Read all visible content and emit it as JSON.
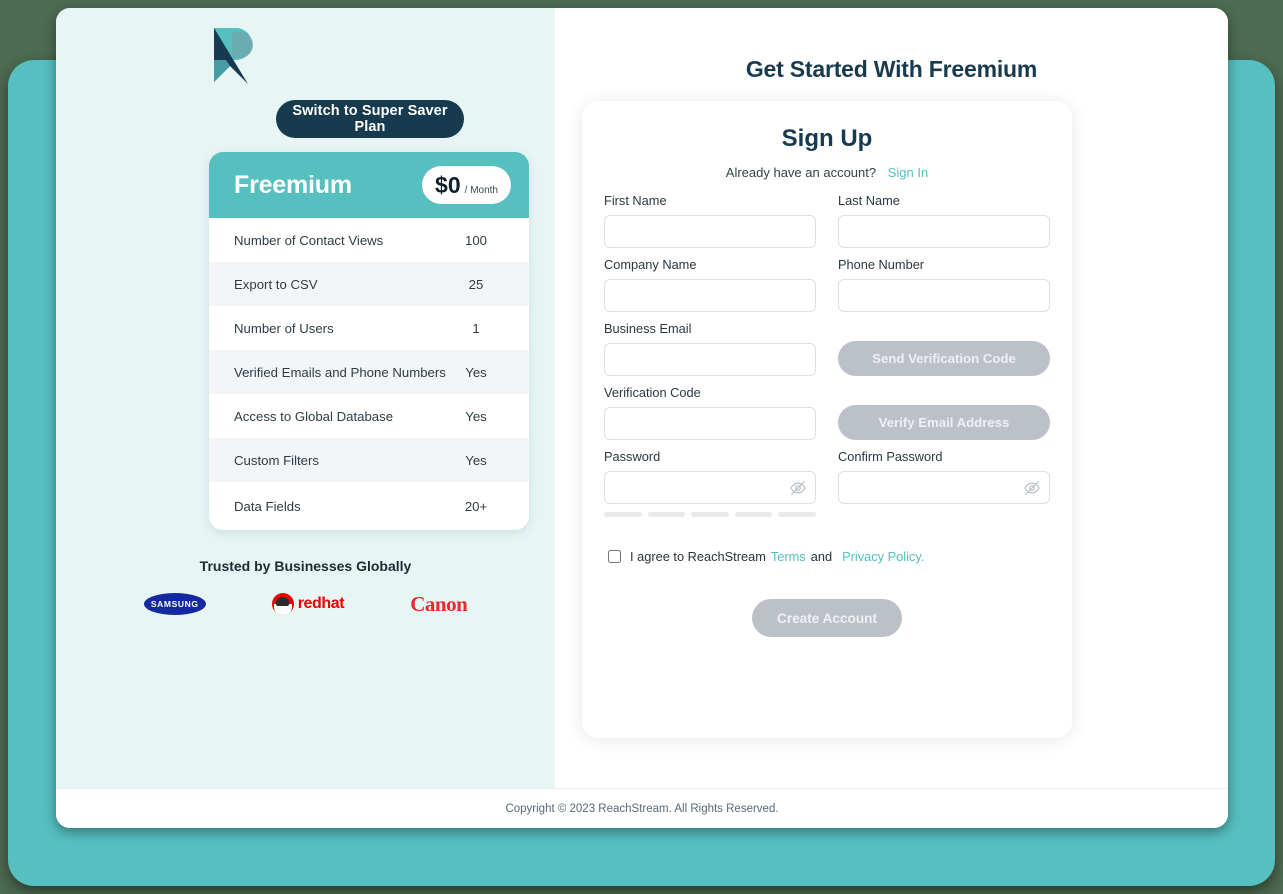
{
  "brand": {
    "logo_icon": "reachstream-r-logo",
    "logo_colors": {
      "teal": "#56bfc0",
      "navy": "#173a4e"
    }
  },
  "left": {
    "switch_plan_button": "Switch to Super Saver Plan",
    "plan": {
      "name": "Freemium",
      "price": "$0",
      "period": "/ Month",
      "features": [
        {
          "label": "Number of Contact Views",
          "value": "100"
        },
        {
          "label": "Export to CSV",
          "value": "25"
        },
        {
          "label": "Number of Users",
          "value": "1"
        },
        {
          "label": "Verified Emails and Phone Numbers",
          "value": "Yes"
        },
        {
          "label": "Access to Global Database",
          "value": "Yes"
        },
        {
          "label": "Custom Filters",
          "value": "Yes"
        },
        {
          "label": "Data Fields",
          "value": "20+"
        }
      ]
    },
    "trusted_heading": "Trusted by Businesses Globally",
    "logos": [
      {
        "name": "SAMSUNG",
        "icon": "samsung-logo"
      },
      {
        "name": "redhat",
        "icon": "redhat-logo"
      },
      {
        "name": "Canon",
        "icon": "canon-logo"
      }
    ]
  },
  "right": {
    "page_title": "Get Started With Freemium",
    "form_title": "Sign Up",
    "already_have_account": "Already have an account?",
    "sign_in_link": "Sign In",
    "fields": {
      "first_name": {
        "label": "First Name",
        "value": "",
        "placeholder": ""
      },
      "last_name": {
        "label": "Last Name",
        "value": "",
        "placeholder": ""
      },
      "company_name": {
        "label": "Company Name",
        "value": "",
        "placeholder": ""
      },
      "phone_number": {
        "label": "Phone Number",
        "value": "",
        "placeholder": ""
      },
      "business_email": {
        "label": "Business Email",
        "value": "",
        "placeholder": ""
      },
      "verification_code": {
        "label": "Verification Code",
        "value": "",
        "placeholder": ""
      },
      "password": {
        "label": "Password",
        "value": "",
        "placeholder": ""
      },
      "confirm_password": {
        "label": "Confirm Password",
        "value": "",
        "placeholder": ""
      }
    },
    "buttons": {
      "send_verification_code": "Send Verification Code",
      "verify_email_address": "Verify Email Address",
      "create_account": "Create Account"
    },
    "password_strength": {
      "segments": 5,
      "filled": 0,
      "empty_color": "#e8eaec"
    },
    "terms": {
      "text_before": "I agree to ReachStream",
      "terms_link": "Terms",
      "conjunction": "and",
      "privacy_link": "Privacy Policy.",
      "checked": false
    },
    "eye_icon": "eye-off-icon"
  },
  "footer": {
    "copyright": "Copyright © 2023 ReachStream. All Rights Reserved."
  },
  "colors": {
    "teal": "#56bfc0",
    "teal_light": "#e7f5f5",
    "navy": "#173a4e",
    "disabled_grey": "#bcc1c8"
  }
}
